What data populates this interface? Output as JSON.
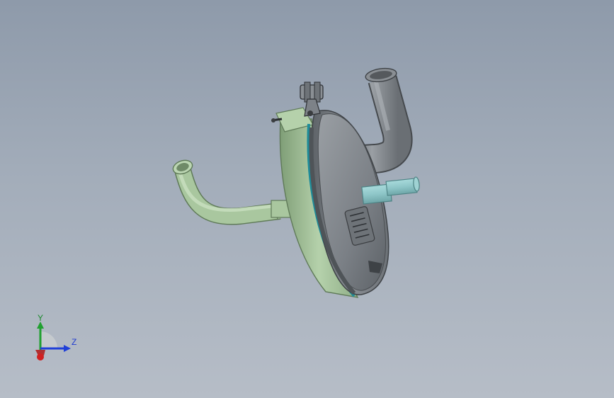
{
  "triad": {
    "y_label": "Y",
    "z_label": "Z",
    "colors": {
      "y_axis": "#20a030",
      "z_axis": "#2040d8",
      "x_axis": "#d02020"
    }
  },
  "colors": {
    "pipe_green": "#a9c79f",
    "body_gray": "#7d8288",
    "shaft_teal": "#8ec6c8",
    "seal_blue": "#1e8c9a"
  }
}
